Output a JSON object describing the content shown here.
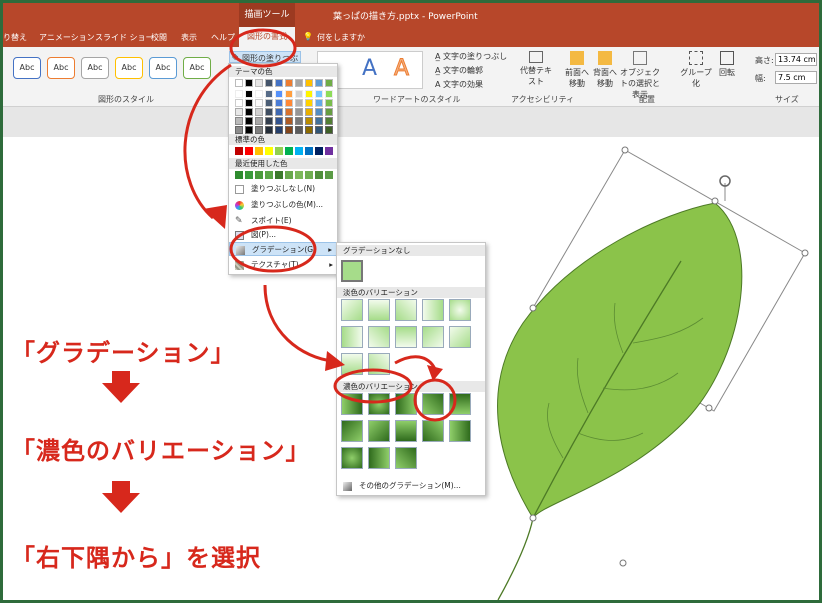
{
  "titlebar": {
    "tool_tab": "描画ツール",
    "doc_title": "葉っぱの描き方.pptx  -  PowerPoint"
  },
  "tabs": [
    {
      "label": "り替え"
    },
    {
      "label": "アニメーション"
    },
    {
      "label": "スライド ショー"
    },
    {
      "label": "校閲"
    },
    {
      "label": "表示"
    },
    {
      "label": "ヘルプ"
    }
  ],
  "active_tab": "図形の書式",
  "tell_me": "何をしますか",
  "ribbon": {
    "style_sample": "Abc",
    "fill_button": "図形の塗りつぶし",
    "shape_styles_label": "図形のスタイル",
    "wordart_label": "ワードアートのスタイル",
    "text_fill": "文字の塗りつぶし",
    "text_outline": "文字の輪郭",
    "text_effect": "文字の効果",
    "alt_text": "代替テキスト",
    "accessibility_label": "アクセシビリティ",
    "bring_forward": "前面へ移動",
    "send_backward": "背面へ移動",
    "selection_pane": "オブジェクトの選択と表示",
    "group": "グループ化",
    "rotate": "回転",
    "arrange_label": "配置",
    "height_label": "高さ:",
    "height_value": "13.74 cm",
    "width_label": "幅:",
    "width_value": "7.5 cm",
    "size_label": "サイズ"
  },
  "fill_menu": {
    "theme_colors": "テーマの色",
    "standard_colors": "標準の色",
    "recent_colors": "最近使用した色",
    "no_fill": "塗りつぶしなし(N)",
    "more_colors": "塗りつぶしの色(M)...",
    "eyedropper": "スポイト(E)",
    "picture": "図(P)...",
    "gradient": "グラデーション(G)",
    "texture": "テクスチャ(T)"
  },
  "gradient_menu": {
    "no_gradient": "グラデーションなし",
    "light_variations": "淡色のバリエーション",
    "dark_variations": "濃色のバリエーション",
    "more_gradients": "その他のグラデーション(M)..."
  },
  "captions": {
    "step1": "「グラデーション」",
    "step2": "「濃色のバリエーション」",
    "step3": "「右下隅から」を選択"
  },
  "colors": {
    "accent_red": "#d7281c",
    "ribbon_red": "#b7472a",
    "leaf_green": "#8bc34a",
    "frame_green": "#2e6b3b"
  },
  "icons": {
    "fill_bucket": "paint-bucket-icon",
    "eyedropper": "eyedropper-icon",
    "rotate_handle": "rotate-icon"
  }
}
